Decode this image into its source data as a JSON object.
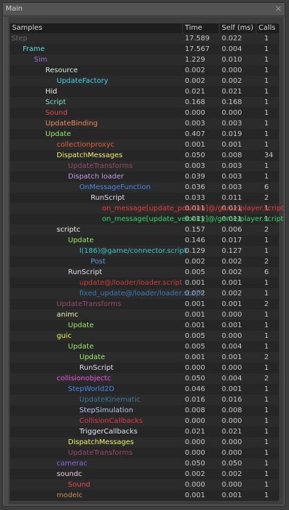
{
  "window": {
    "title": "Main",
    "close": "×"
  },
  "columns": [
    "Samples",
    "Time (ms)",
    "Self (ms)",
    "Calls"
  ],
  "rows": [
    {
      "name": "Step",
      "depth": 0,
      "color": "#6a6a6a",
      "time": "17.589",
      "self": "0.022",
      "calls": "1"
    },
    {
      "name": "Frame",
      "depth": 1,
      "color": "#5ee0e6",
      "time": "17.567",
      "self": "0.004",
      "calls": "1"
    },
    {
      "name": "Sim",
      "depth": 2,
      "color": "#9a6ae6",
      "time": "1.229",
      "self": "0.010",
      "calls": "1"
    },
    {
      "name": "Resource",
      "depth": 3,
      "color": "#d8ecd8",
      "time": "0.002",
      "self": "0.000",
      "calls": "1"
    },
    {
      "name": "UpdateFactory",
      "depth": 4,
      "color": "#3ad8e8",
      "time": "0.002",
      "self": "0.002",
      "calls": "1"
    },
    {
      "name": "Hid",
      "depth": 3,
      "color": "#f4f0dc",
      "time": "0.021",
      "self": "0.021",
      "calls": "1"
    },
    {
      "name": "Script",
      "depth": 3,
      "color": "#7ee0c8",
      "time": "0.168",
      "self": "0.168",
      "calls": "1"
    },
    {
      "name": "Sound",
      "depth": 3,
      "color": "#e84a4a",
      "time": "0.000",
      "self": "0.000",
      "calls": "1"
    },
    {
      "name": "UpdateBinding",
      "depth": 3,
      "color": "#f08a5a",
      "time": "0.003",
      "self": "0.003",
      "calls": "1"
    },
    {
      "name": "Update",
      "depth": 3,
      "color": "#9ee86a",
      "time": "0.407",
      "self": "0.019",
      "calls": "1"
    },
    {
      "name": "collectionproxyc",
      "depth": 4,
      "color": "#e8603a",
      "time": "0.001",
      "self": "0.001",
      "calls": "1"
    },
    {
      "name": "DispatchMessages",
      "depth": 4,
      "color": "#f4f46a",
      "time": "0.050",
      "self": "0.008",
      "calls": "34"
    },
    {
      "name": "UpdateTransforms",
      "depth": 5,
      "color": "#9a4a6a",
      "time": "0.003",
      "self": "0.003",
      "calls": "1"
    },
    {
      "name": "Dispatch loader",
      "depth": 5,
      "color": "#c89ae8",
      "time": "0.039",
      "self": "0.003",
      "calls": "1"
    },
    {
      "name": "OnMessageFunction",
      "depth": 6,
      "color": "#4a8ae8",
      "time": "0.036",
      "self": "0.003",
      "calls": "6"
    },
    {
      "name": "RunScript",
      "depth": 7,
      "color": "#e0dcf0",
      "time": "0.033",
      "self": "0.011",
      "calls": "2"
    },
    {
      "name": "on_message[update_position]@/game/player.script",
      "depth": 8,
      "color": "#f03a3a",
      "time": "0.011",
      "self": "0.011",
      "calls": "1"
    },
    {
      "name": "on_message[update_velocity]@/game/player.script",
      "depth": 8,
      "color": "#3ad86a",
      "time": "0.011",
      "self": "0.011",
      "calls": "1"
    },
    {
      "name": "scriptc",
      "depth": 4,
      "color": "#f0f0f0",
      "time": "0.157",
      "self": "0.006",
      "calls": "2"
    },
    {
      "name": "Update",
      "depth": 5,
      "color": "#9ee86a",
      "time": "0.146",
      "self": "0.017",
      "calls": "1"
    },
    {
      "name": "l(186)@game/connector.script",
      "depth": 6,
      "color": "#3ac8c8",
      "time": "0.129",
      "self": "0.127",
      "calls": "1"
    },
    {
      "name": "Post",
      "depth": 7,
      "color": "#5a9ae0",
      "time": "0.002",
      "self": "0.002",
      "calls": "2"
    },
    {
      "name": "RunScript",
      "depth": 5,
      "color": "#e0dcf0",
      "time": "0.005",
      "self": "0.002",
      "calls": "6"
    },
    {
      "name": "update@/loader/loader.script",
      "depth": 6,
      "color": "#c8403a",
      "time": "0.001",
      "self": "0.001",
      "calls": "1"
    },
    {
      "name": "fixed_update@/loader/loader.script",
      "depth": 6,
      "color": "#3a7ab8",
      "time": "0.002",
      "self": "0.002",
      "calls": "1"
    },
    {
      "name": "UpdateTransforms",
      "depth": 4,
      "color": "#9a4a6a",
      "time": "0.001",
      "self": "0.001",
      "calls": "2"
    },
    {
      "name": "animc",
      "depth": 4,
      "color": "#f4f0b0",
      "time": "0.001",
      "self": "0.000",
      "calls": "1"
    },
    {
      "name": "Update",
      "depth": 5,
      "color": "#9ee86a",
      "time": "0.001",
      "self": "0.001",
      "calls": "1"
    },
    {
      "name": "guic",
      "depth": 4,
      "color": "#f4f43a",
      "time": "0.005",
      "self": "0.000",
      "calls": "1"
    },
    {
      "name": "Update",
      "depth": 5,
      "color": "#9ee86a",
      "time": "0.005",
      "self": "0.004",
      "calls": "1"
    },
    {
      "name": "Update",
      "depth": 6,
      "color": "#9ef06a",
      "time": "0.001",
      "self": "0.001",
      "calls": "2"
    },
    {
      "name": "RunScript",
      "depth": 6,
      "color": "#e0dcf0",
      "time": "0.000",
      "self": "0.000",
      "calls": "1"
    },
    {
      "name": "collisionobjectc",
      "depth": 4,
      "color": "#f05ae0",
      "time": "0.050",
      "self": "0.004",
      "calls": "2"
    },
    {
      "name": "StepWorld2D",
      "depth": 5,
      "color": "#4a8ae8",
      "time": "0.046",
      "self": "0.001",
      "calls": "1"
    },
    {
      "name": "UpdateKinematic",
      "depth": 6,
      "color": "#3a7a9a",
      "time": "0.016",
      "self": "0.016",
      "calls": "1"
    },
    {
      "name": "StepSimulation",
      "depth": 6,
      "color": "#b8c8f0",
      "time": "0.008",
      "self": "0.008",
      "calls": "1"
    },
    {
      "name": "CollisionCallbacks",
      "depth": 6,
      "color": "#e03a4a",
      "time": "0.000",
      "self": "0.000",
      "calls": "1"
    },
    {
      "name": "TriggerCallbacks",
      "depth": 6,
      "color": "#e0e8f4",
      "time": "0.021",
      "self": "0.021",
      "calls": "1"
    },
    {
      "name": "DispatchMessages",
      "depth": 5,
      "color": "#f4f46a",
      "time": "0.000",
      "self": "0.000",
      "calls": "1"
    },
    {
      "name": "UpdateTransforms",
      "depth": 5,
      "color": "#9a4a6a",
      "time": "0.000",
      "self": "0.000",
      "calls": "1"
    },
    {
      "name": "camerac",
      "depth": 4,
      "color": "#8a6ae8",
      "time": "0.050",
      "self": "0.050",
      "calls": "1"
    },
    {
      "name": "soundc",
      "depth": 4,
      "color": "#f0c8e8",
      "time": "0.002",
      "self": "0.002",
      "calls": "1"
    },
    {
      "name": "Sound",
      "depth": 5,
      "color": "#e84a4a",
      "time": "0.000",
      "self": "0.000",
      "calls": "1"
    },
    {
      "name": "modelc",
      "depth": 4,
      "color": "#c8905a",
      "time": "0.001",
      "self": "0.001",
      "calls": "1"
    }
  ]
}
